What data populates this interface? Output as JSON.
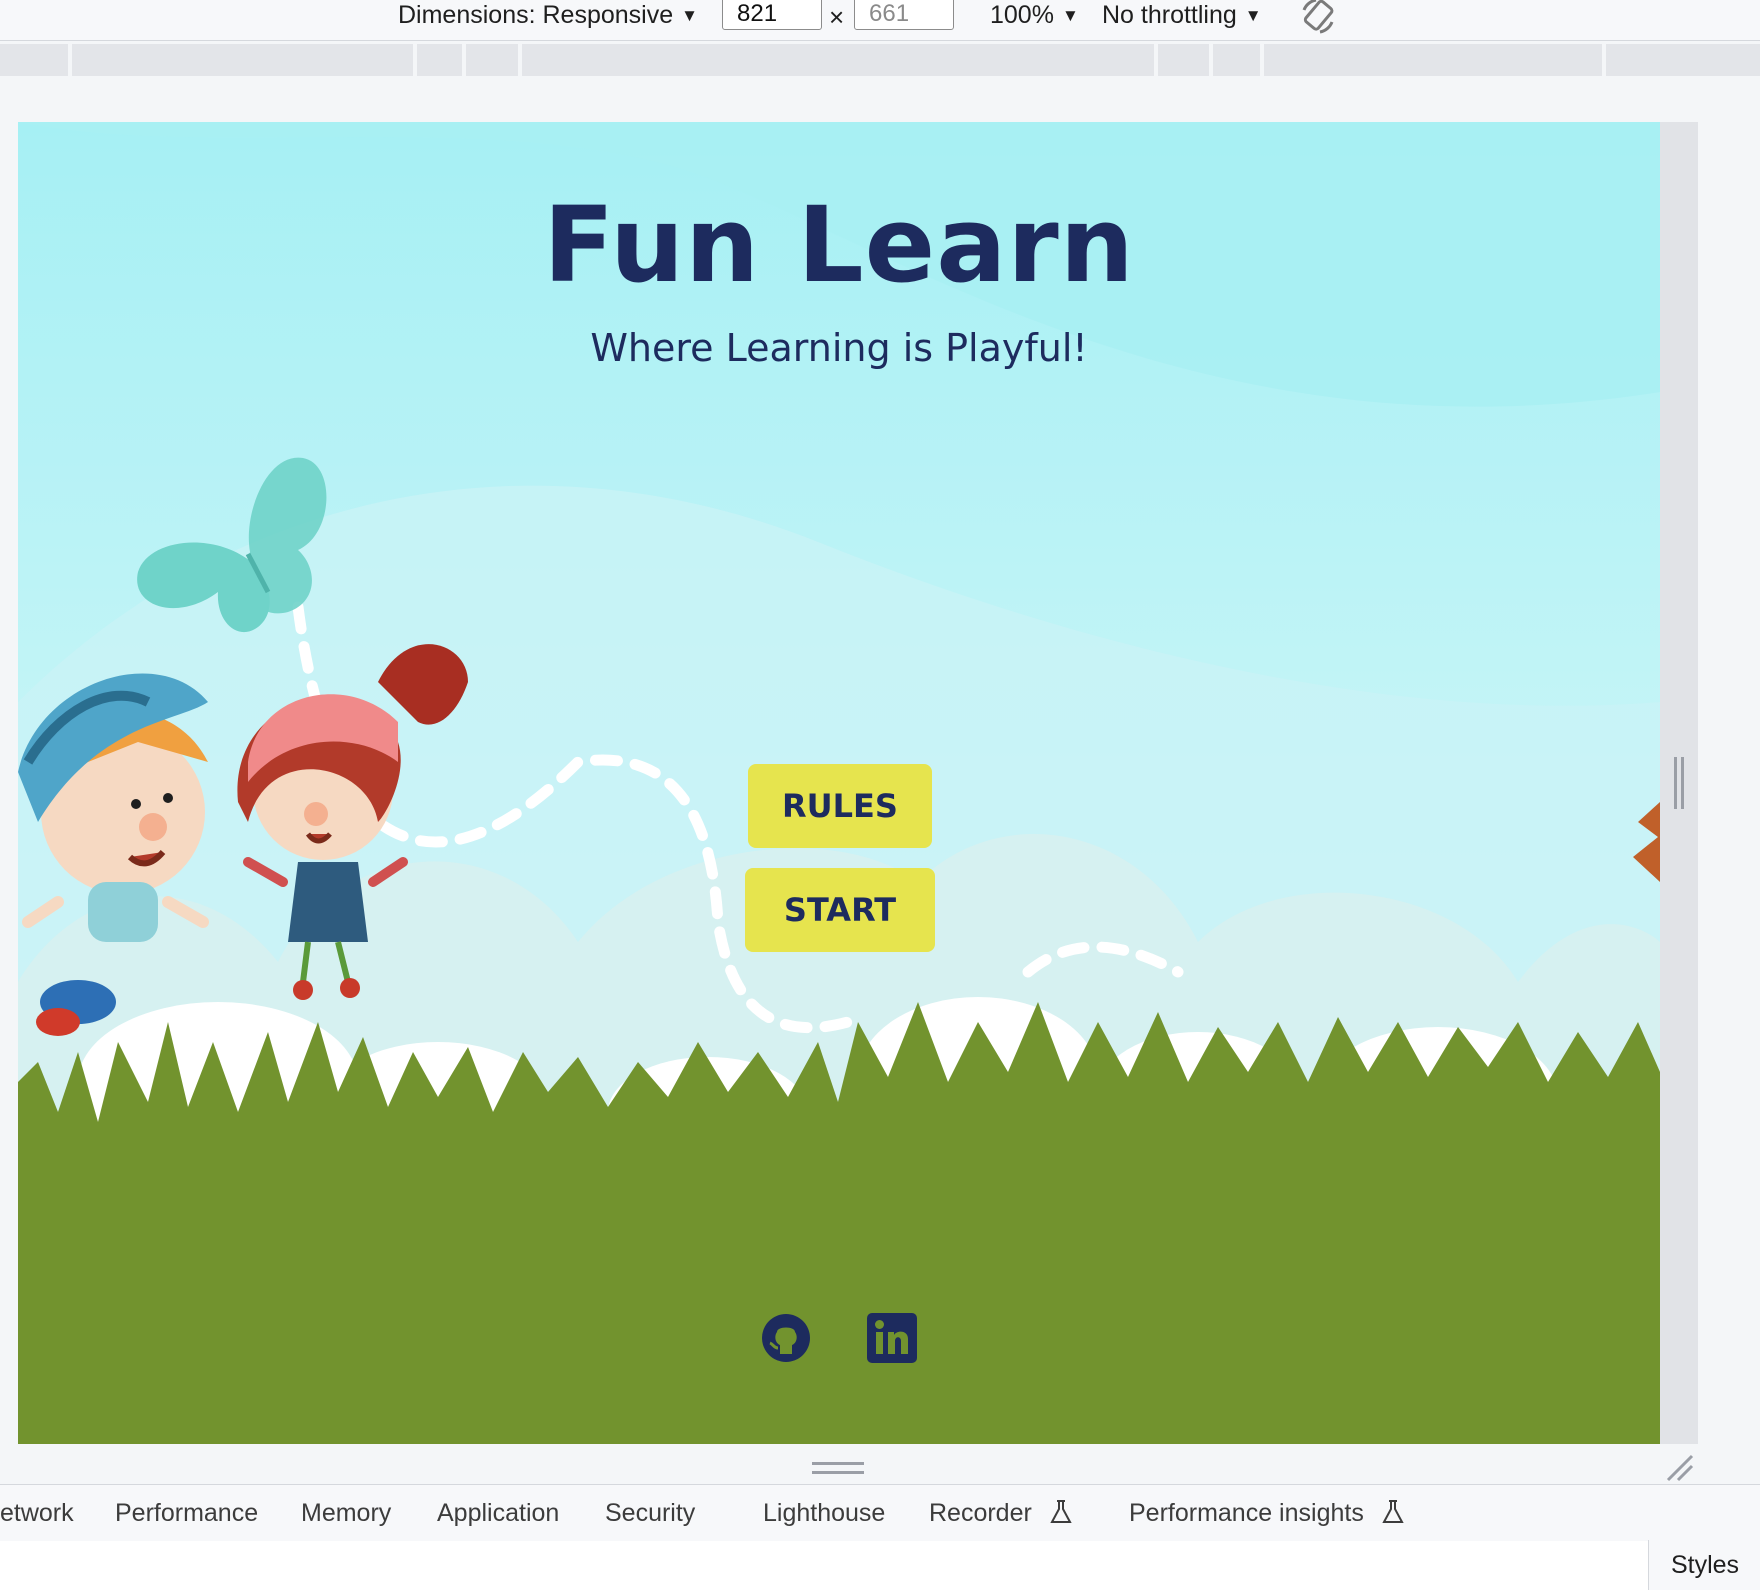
{
  "devtools": {
    "dimensions_label": "Dimensions: Responsive",
    "width_value": "821",
    "height_value": "661",
    "zoom_label": "100%",
    "throttling_label": "No throttling",
    "times_symbol": "×",
    "tabs": [
      {
        "label": "etwork"
      },
      {
        "label": "Performance"
      },
      {
        "label": "Memory"
      },
      {
        "label": "Application"
      },
      {
        "label": "Security"
      },
      {
        "label": "Lighthouse"
      },
      {
        "label": "Recorder"
      },
      {
        "label": "Performance insights"
      }
    ],
    "styles_label": "Styles"
  },
  "page": {
    "title": "Fun Learn",
    "subtitle": "Where Learning is Playful!",
    "rules_button": "RULES",
    "start_button": "START",
    "social": [
      {
        "icon": "github-icon"
      },
      {
        "icon": "linkedin-icon"
      }
    ]
  },
  "colors": {
    "sky": "#a9eef4",
    "grass": "#72932e",
    "text_dark": "#1d2b5e",
    "button_yellow": "#e6e44e",
    "butterfly": "#6fd3c9"
  }
}
